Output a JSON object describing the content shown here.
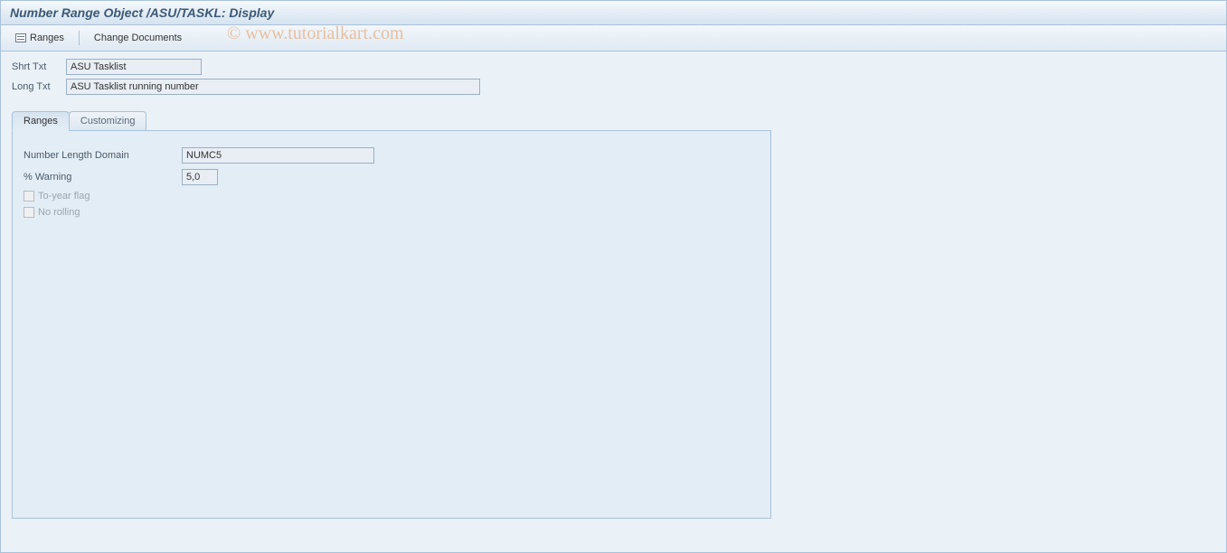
{
  "title": "Number Range Object /ASU/TASKL: Display",
  "toolbar": {
    "ranges_button": "Ranges",
    "change_docs_button": "Change Documents"
  },
  "watermark": "© www.tutorialkart.com",
  "header_fields": {
    "short_text_label": "Shrt Txt",
    "short_text_value": "ASU Tasklist",
    "long_text_label": "Long Txt",
    "long_text_value": "ASU Tasklist running number"
  },
  "tabs": {
    "ranges": "Ranges",
    "customizing": "Customizing"
  },
  "ranges_tab": {
    "number_length_domain_label": "Number Length Domain",
    "number_length_domain_value": "NUMC5",
    "warning_label": "% Warning",
    "warning_value": "5,0",
    "to_year_flag_label": "To-year flag",
    "to_year_flag_checked": false,
    "no_rolling_label": "No rolling",
    "no_rolling_checked": false
  }
}
